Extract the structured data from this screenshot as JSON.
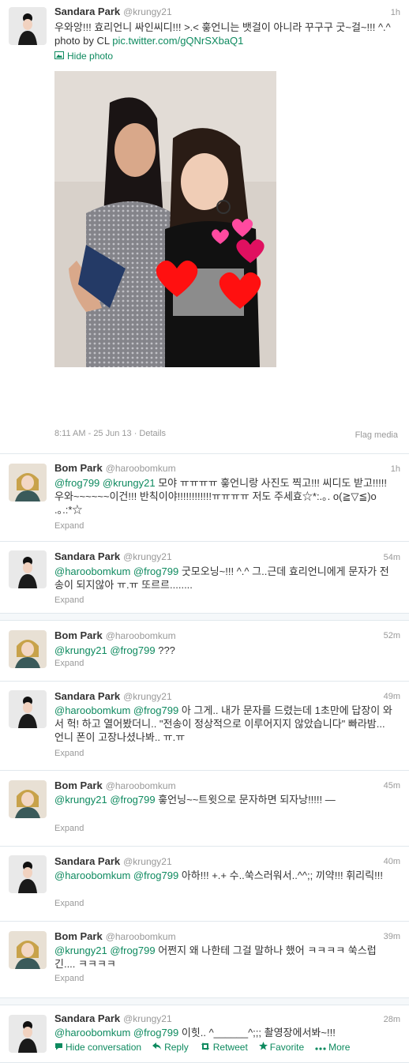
{
  "tweets": [
    {
      "name": "Sandara Park",
      "handle": "@krungy21",
      "time": "1h",
      "text_before": "우와앙!!! 효리언니 싸인씨디!!! >.< 흫언니는 뱃걸이 아니라 꾸구구 굿~걸~!!! ^.^ photo by CL ",
      "link": "pic.twitter.com/gQNrSXbaQ1",
      "hide_photo": "Hide photo",
      "meta": "8:11 AM - 25 Jun 13 · Details",
      "flag": "Flag media"
    },
    {
      "name": "Bom Park",
      "handle": "@haroobomkum",
      "time": "1h",
      "mentions": [
        "@frog799",
        "@krungy21"
      ],
      "text": " 모야 ㅠㅠㅠㅠ 흫언니랑 사진도 찍고!!! 씨디도 받고!!!!! 우와~~~~~~이건!!! 반칙이야!!!!!!!!!!!!ㅠㅠㅠㅠ 저도 주세효☆*:.｡. o(≧▽≦)o .｡.:*☆",
      "expand": "Expand"
    },
    {
      "name": "Sandara Park",
      "handle": "@krungy21",
      "time": "54m",
      "mentions": [
        "@haroobomkum",
        "@frog799"
      ],
      "text": " 굿모오닝~!!! ^.^ 그..근데 효리언니에게 문자가 전송이 되지않아 ㅠ.ㅠ 또르르........",
      "expand": "Expand"
    },
    {
      "name": "Bom Park",
      "handle": "@haroobomkum",
      "time": "52m",
      "mentions": [
        "@krungy21",
        "@frog799"
      ],
      "text": " ???",
      "expand": "Expand"
    },
    {
      "name": "Sandara Park",
      "handle": "@krungy21",
      "time": "49m",
      "mentions": [
        "@haroobomkum",
        "@frog799"
      ],
      "text": " 아 그게.. 내가 문자를 드렸는데 1초만에 답장이 와서 헉! 하고 열어봤더니.. \"전송이 정상적으로 이루어지지 않았습니다\" 빠라밤... 언니 폰이 고장나셨나봐.. ㅠ.ㅠ",
      "expand": "Expand"
    },
    {
      "name": "Bom Park",
      "handle": "@haroobomkum",
      "time": "45m",
      "mentions": [
        "@krungy21",
        "@frog799"
      ],
      "text": " 흫언닝~~트윗으로 문자하면 되자낭!!!!! —",
      "expand": "Expand"
    },
    {
      "name": "Sandara Park",
      "handle": "@krungy21",
      "time": "40m",
      "mentions": [
        "@haroobomkum",
        "@frog799"
      ],
      "text": " 아하!!! +.+ 수..쑥스러워서..^^;; 끼약!!! 휘리릭!!!",
      "expand": "Expand"
    },
    {
      "name": "Bom Park",
      "handle": "@haroobomkum",
      "time": "39m",
      "mentions": [
        "@krungy21",
        "@frog799"
      ],
      "text": " 어쩐지 왜 나한테 그걸 말하나 했어 ㅋㅋㅋㅋ 쑥스럽긴.... ㅋㅋㅋㅋ",
      "expand": "Expand"
    },
    {
      "name": "Sandara Park",
      "handle": "@krungy21",
      "time": "28m",
      "mentions": [
        "@haroobomkum",
        "@frog799"
      ],
      "text": " 이힛.. ^______^;;; 촬영장에서봐~!!!",
      "actions": {
        "hide_conversation": "Hide conversation",
        "reply": "Reply",
        "retweet": "Retweet",
        "favorite": "Favorite",
        "more": "More"
      }
    }
  ],
  "colors": {
    "link": "#0e8a5f",
    "muted": "#999999",
    "name": "#333333"
  }
}
